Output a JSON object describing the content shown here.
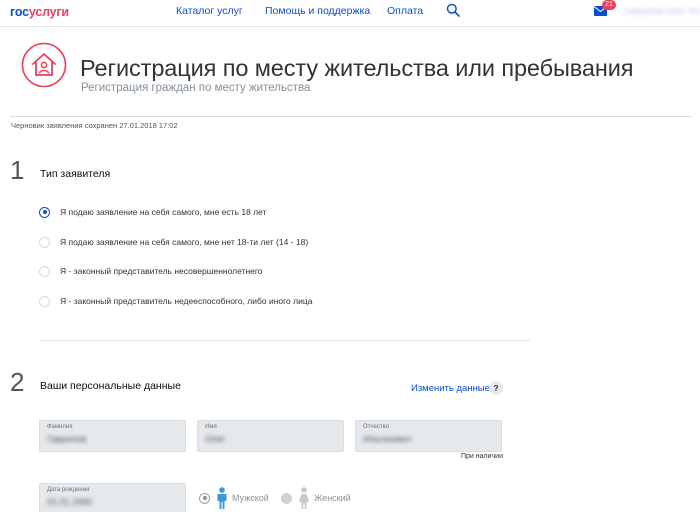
{
  "header": {
    "logo_part1": "гос",
    "logo_part2": "услуги",
    "nav": [
      "Каталог услуг",
      "Помощь и поддержка",
      "Оплата"
    ],
    "mail_count": "21",
    "user_name": "Гаврилов Олег Ил."
  },
  "service": {
    "title": "Регистрация по месту жительства или пребывания",
    "subtitle": "Регистрация граждан по месту жительства",
    "draft_info": "Черновик заявления сохранен 27.01.2018 17:02"
  },
  "step1": {
    "number": "1",
    "title": "Тип заявителя",
    "options": [
      {
        "label": "Я подаю заявление на себя самого, мне есть 18 лет",
        "checked": true
      },
      {
        "label": "Я подаю заявление на себя самого, мне нет 18-ти лет (14 - 18)",
        "checked": false
      },
      {
        "label": "Я - законный представитель несовершеннолетнего",
        "checked": false
      },
      {
        "label": "Я - законный представитель недееспособного, либо иного лица",
        "checked": false
      }
    ]
  },
  "step2": {
    "number": "2",
    "title": "Ваши персональные данные",
    "edit_link": "Изменить данные",
    "help": "?",
    "fields": {
      "surname": {
        "label": "Фамилия",
        "value": "Гаврилов"
      },
      "name": {
        "label": "Имя",
        "value": "Олег"
      },
      "patronymic": {
        "label": "Отчество",
        "value": "Ильгизович"
      },
      "birthdate": {
        "label": "Дата рождения",
        "value": "01.01.1990"
      }
    },
    "patronymic_hint": "При наличии",
    "gender": {
      "male": "Мужской",
      "female": "Женский",
      "selected": "male"
    }
  },
  "colors": {
    "brand_blue": "#0d4cd3",
    "brand_red": "#ee3f58",
    "male_icon": "#3c9ad6",
    "female_icon": "#c5cad0"
  }
}
